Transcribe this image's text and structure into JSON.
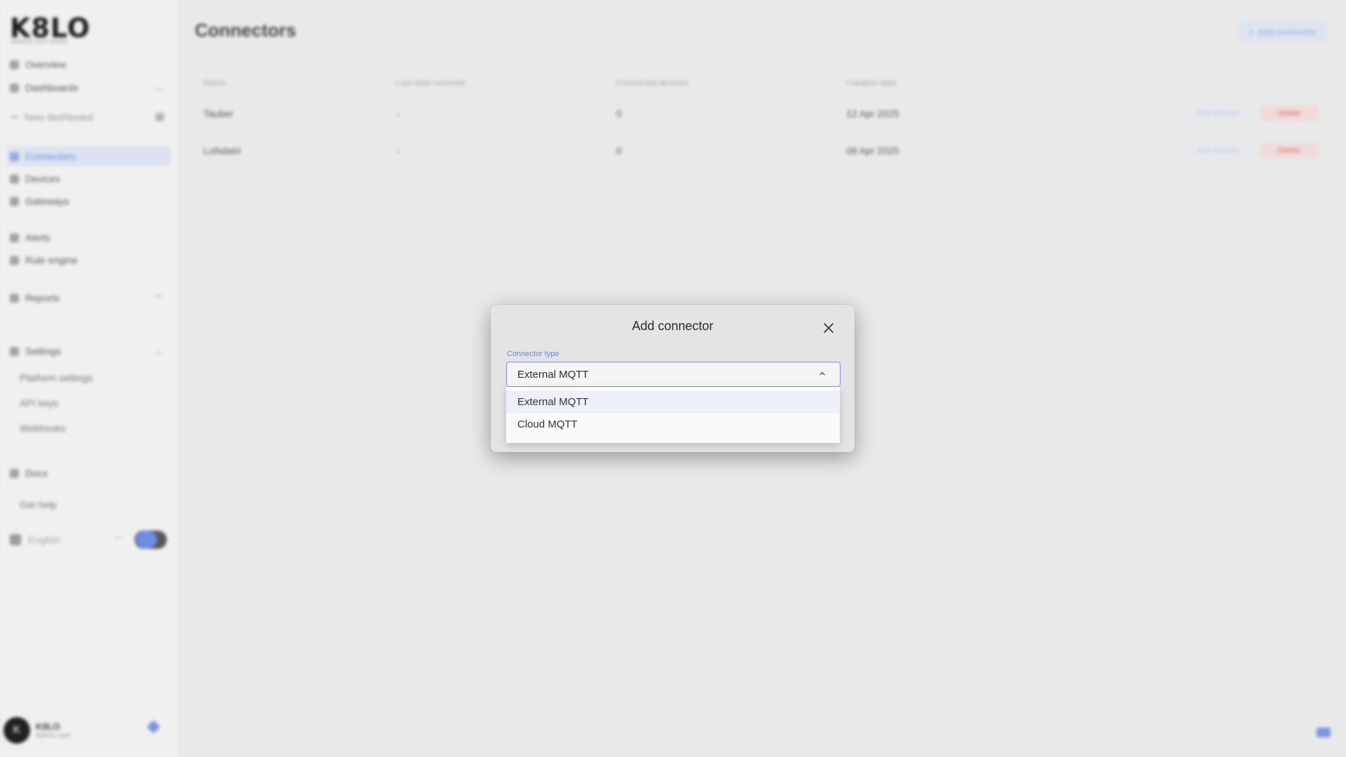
{
  "app": {
    "logo": "K8LO",
    "logo_sub": "MAKING DATA WORK",
    "nav": {
      "overview": "Overview",
      "dashboards": "Dashboards",
      "new_dashboard": "New dashboard",
      "connectors": "Connectors",
      "devices": "Devices",
      "gateways": "Gateways",
      "alerts": "Alerts",
      "rule_engine": "Rule engine",
      "reports": "Reports",
      "settings": "Settings",
      "platform_settings": "Platform settings",
      "api_keys": "API keys",
      "webhooks": "Webhooks",
      "docs": "Docs",
      "get_help": "Get help"
    },
    "language": "English",
    "user": {
      "initial": "K",
      "name": "K8LO",
      "sub": "Admin user"
    }
  },
  "page": {
    "title": "Connectors",
    "add_button": "Add connector",
    "columns": [
      "Name",
      "Last data received",
      "Connected devices",
      "Creation date"
    ],
    "rows": [
      {
        "name": "Tauber",
        "last": "-",
        "devices": "0",
        "created": "12 Apr 2025",
        "action": "Edit devices",
        "delete": "Delete"
      },
      {
        "name": "Lofsdahl",
        "last": "-",
        "devices": "0",
        "created": "08 Apr 2025",
        "action": "Edit devices",
        "delete": "Delete"
      }
    ]
  },
  "dialog": {
    "title": "Add connector",
    "field_label": "Connector type",
    "selected_value": "External MQTT",
    "options": [
      "External MQTT",
      "Cloud MQTT"
    ]
  },
  "icons": {
    "close": "close-icon",
    "chevron_up": "chevron-up-icon"
  },
  "colors": {
    "accent": "#6f8ff0",
    "danger": "#e56a6a"
  }
}
